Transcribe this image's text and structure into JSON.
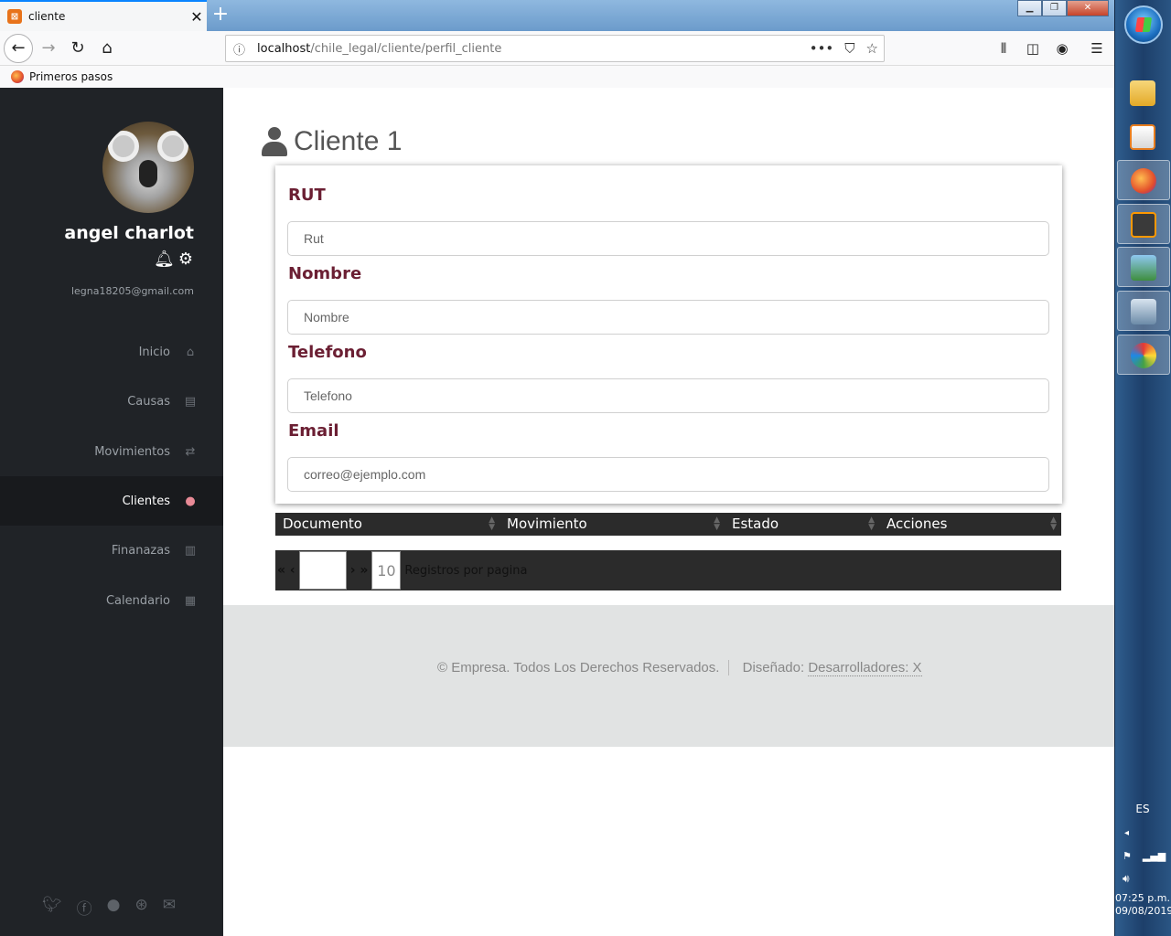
{
  "browser": {
    "tab_title": "cliente",
    "url_host": "localhost",
    "url_path": "/chile_legal/cliente/perfil_cliente",
    "bookmark": "Primeros pasos"
  },
  "sidebar": {
    "username": "angel charlot",
    "email": "legna18205@gmail.com",
    "menu": [
      {
        "label": "Inicio",
        "icon": "home-icon"
      },
      {
        "label": "Causas",
        "icon": "document-icon"
      },
      {
        "label": "Movimientos",
        "icon": "exchange-icon"
      },
      {
        "label": "Clientes",
        "icon": "user-icon",
        "active": true
      },
      {
        "label": "Finanazas",
        "icon": "bar-chart-icon"
      },
      {
        "label": "Calendario",
        "icon": "calendar-icon"
      }
    ],
    "social": [
      "twitter-icon",
      "facebook-icon",
      "github-icon",
      "dribbble-icon",
      "envelope-icon"
    ]
  },
  "page": {
    "title": "Cliente 1"
  },
  "form": {
    "rut_label": "RUT",
    "rut_placeholder": "Rut",
    "nombre_label": "Nombre",
    "nombre_placeholder": "Nombre",
    "telefono_label": "Telefono",
    "telefono_placeholder": "Telefono",
    "email_label": "Email",
    "email_placeholder": "correo@ejemplo.com"
  },
  "table": {
    "columns": [
      "Documento",
      "Movimiento",
      "Estado",
      "Acciones"
    ]
  },
  "pager": {
    "first_prev": "« ‹",
    "next_last": "› »",
    "per_page": "10",
    "per_page_label": "Registros por pagina"
  },
  "footer": {
    "copyright": "© Empresa. Todos Los Derechos Reservados.",
    "designed_label": "Diseñado:",
    "designed_link": "Desarrolladores: X"
  },
  "taskbar": {
    "lang": "ES",
    "time": "07:25 p.m.",
    "date": "09/08/2019"
  },
  "colors": {
    "label_color": "#6b1f33",
    "sidebar_bg": "#202327",
    "table_header_bg": "#2b2b2b",
    "footer_bg": "#e1e3e3"
  }
}
